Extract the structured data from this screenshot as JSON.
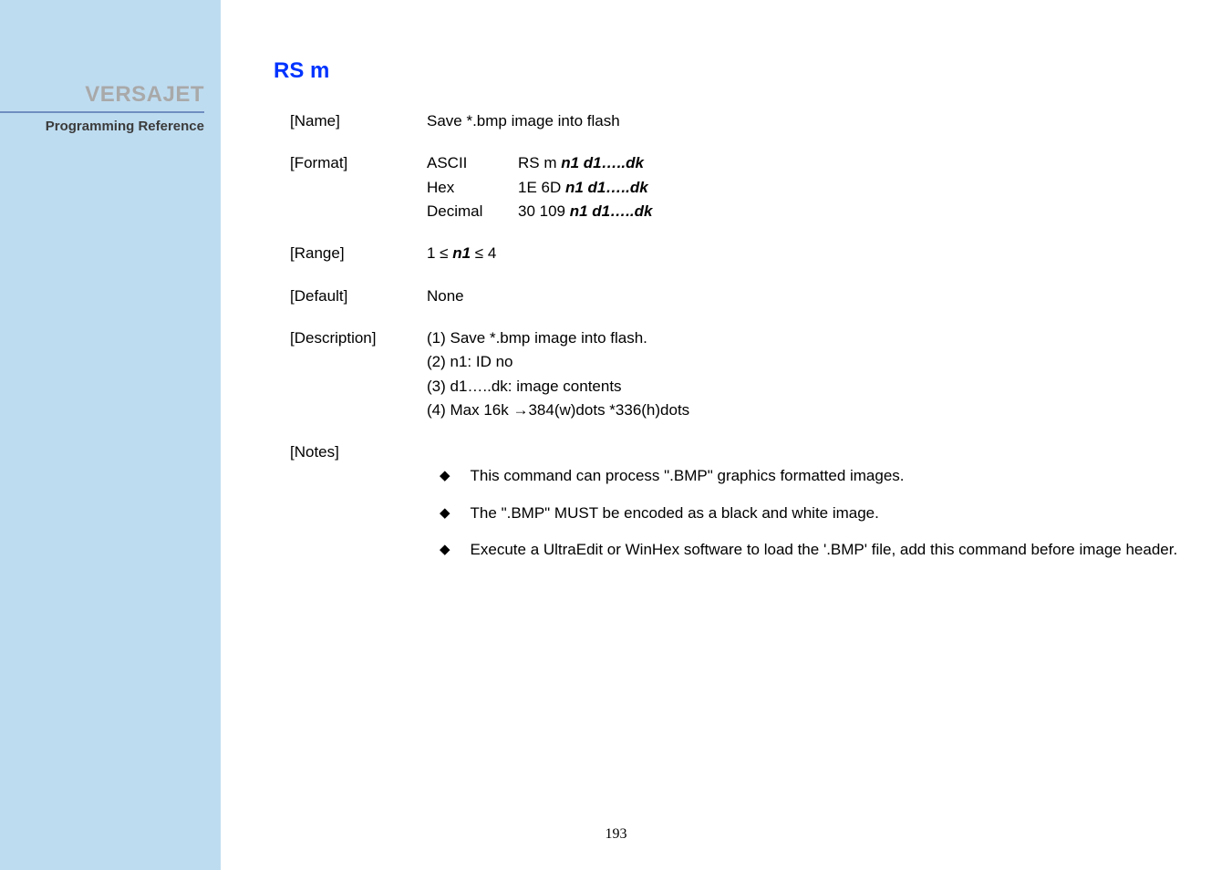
{
  "sidebar": {
    "brand": "VERSAJET",
    "subtitle": "Programming Reference"
  },
  "page": {
    "heading": "RS m",
    "page_number": "193"
  },
  "fields": {
    "name_label": "[Name]",
    "name_value": "Save *.bmp image into flash",
    "format_label": "[Format]",
    "format": {
      "ascii_key": "ASCII",
      "ascii_prefix": "RS m ",
      "ascii_ital": "n1 d1…..dk",
      "hex_key": "Hex",
      "hex_prefix": "1E 6D ",
      "hex_ital": "n1 d1…..dk",
      "dec_key": "Decimal",
      "dec_prefix": "30 109 ",
      "dec_ital": "n1 d1…..dk"
    },
    "range_label": "[Range]",
    "range_prefix": "1 ≤ ",
    "range_ital": "n1",
    "range_suffix": " ≤ 4",
    "default_label": "[Default]",
    "default_value": "None",
    "description_label": "[Description]",
    "description": {
      "l1": " (1) Save *.bmp image into flash.",
      "l2": "(2) n1: ID no",
      "l3": "(3) d1…..dk: image contents",
      "l4": "(4) Max 16k →384(w)dots *336(h)dots"
    },
    "notes_label": "[Notes]",
    "notes": [
      "This command can process \".BMP\" graphics formatted images.",
      "The \".BMP\" MUST be encoded as a black and white image.",
      "Execute a UltraEdit or WinHex software to load the '.BMP' file, add this command before image header."
    ]
  }
}
